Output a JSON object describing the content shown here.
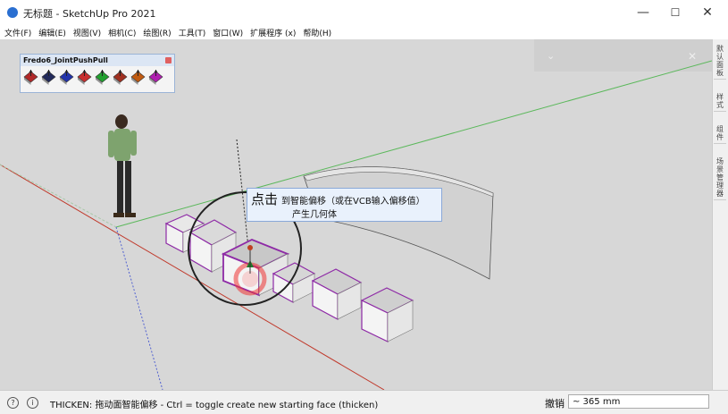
{
  "window": {
    "title": "无标题 - SketchUp Pro 2021",
    "minimize": "—",
    "maximize": "☐",
    "close": "✕"
  },
  "menu": [
    "文件(F)",
    "编辑(E)",
    "视图(V)",
    "相机(C)",
    "绘图(R)",
    "工具(T)",
    "窗口(W)",
    "扩展程序 (x)",
    "帮助(H)"
  ],
  "toolbar": {
    "title": "Fredo6_JointPushPull",
    "button_count_colors": [
      "#b02828",
      "#222a5a",
      "#2233aa",
      "#c83030",
      "#22a030",
      "#a03020",
      "#c05a10",
      "#b020b0"
    ]
  },
  "tooltip": {
    "big": "点击",
    "line1": "到智能偏移（或在VCB输入偏移值）",
    "line2": "产生几何体"
  },
  "right_panel": {
    "tabs": [
      "默认面板",
      "样式",
      "组件",
      "场景管理器"
    ]
  },
  "status": {
    "text": "THICKEN: 拖动面智能偏移 - Ctrl = toggle create new starting face (thicken)",
    "measure_label": "撤销",
    "measure_value": "~ 365 mm"
  },
  "colors": {
    "viewport_bg": "#d7d7d7",
    "edge_purple": "#8e2aa6",
    "axis_red": "#c0392b",
    "axis_green": "#4caf50",
    "axis_blue": "#2a4fd1"
  }
}
